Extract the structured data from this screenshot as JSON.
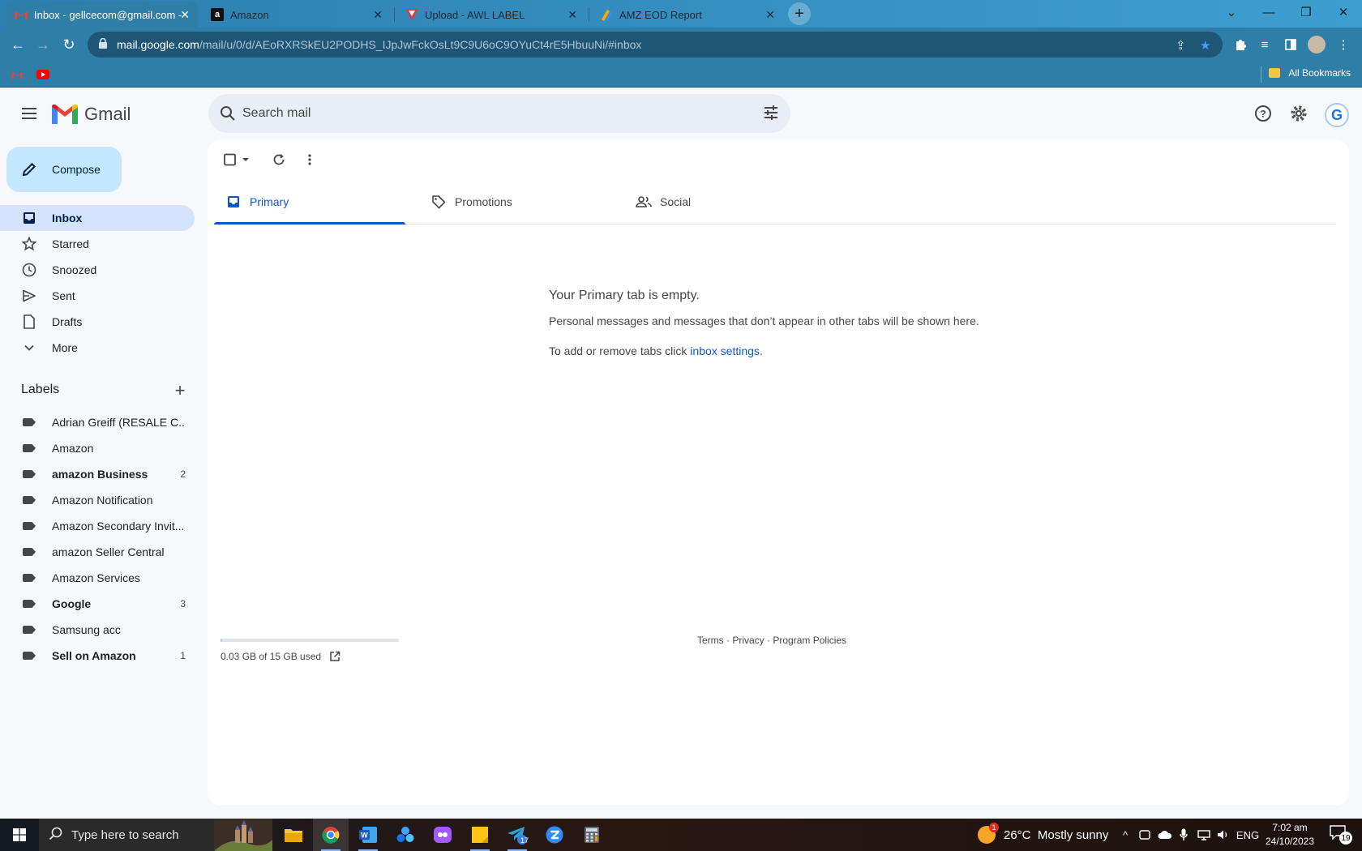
{
  "browser": {
    "tabs": [
      {
        "title": "Inbox - gellcecom@gmail.com -",
        "icon": "gmail-icon",
        "active": true
      },
      {
        "title": "Amazon",
        "icon": "amazon-icon",
        "active": false
      },
      {
        "title": "Upload - AWL LABEL",
        "icon": "awl-icon",
        "active": false
      },
      {
        "title": "AMZ EOD Report",
        "icon": "report-icon",
        "active": false
      }
    ],
    "url_host": "mail.google.com",
    "url_path": "/mail/u/0/d/AEoRXRSkEU2PODHS_IJpJwFckOsLt9C9U6oC9OYuCt4rE5HbuuNi/#inbox",
    "bookmarks_label": "All Bookmarks"
  },
  "gmail": {
    "logo_text": "Gmail",
    "search_placeholder": "Search mail",
    "compose_label": "Compose",
    "nav": [
      {
        "label": "Inbox",
        "icon": "inbox-icon",
        "active": true
      },
      {
        "label": "Starred",
        "icon": "star-icon"
      },
      {
        "label": "Snoozed",
        "icon": "clock-icon"
      },
      {
        "label": "Sent",
        "icon": "send-icon"
      },
      {
        "label": "Drafts",
        "icon": "draft-icon"
      },
      {
        "label": "More",
        "icon": "chevron-down-icon"
      }
    ],
    "labels_title": "Labels",
    "labels": [
      {
        "name": "Adrian Greiff (RESALE C...",
        "count": "",
        "bold": false
      },
      {
        "name": "Amazon",
        "count": "",
        "bold": false
      },
      {
        "name": "amazon Business",
        "count": "2",
        "bold": true
      },
      {
        "name": "Amazon Notification",
        "count": "",
        "bold": false
      },
      {
        "name": "Amazon Secondary Invit...",
        "count": "",
        "bold": false
      },
      {
        "name": "amazon Seller Central",
        "count": "",
        "bold": false
      },
      {
        "name": "Amazon Services",
        "count": "",
        "bold": false
      },
      {
        "name": "Google",
        "count": "3",
        "bold": true
      },
      {
        "name": "Samsung acc",
        "count": "",
        "bold": false
      },
      {
        "name": "Sell on Amazon",
        "count": "1",
        "bold": true
      }
    ],
    "tabs": [
      {
        "label": "Primary",
        "icon": "inbox-tab-icon",
        "active": true
      },
      {
        "label": "Promotions",
        "icon": "tag-icon",
        "active": false
      },
      {
        "label": "Social",
        "icon": "people-icon",
        "active": false
      }
    ],
    "empty": {
      "title": "Your Primary tab is empty.",
      "line1": "Personal messages and messages that don’t appear in other tabs will be shown here.",
      "line2_prefix": "To add or remove tabs click ",
      "line2_link": "inbox settings",
      "line2_suffix": "."
    },
    "storage": {
      "text": "0.03 GB of 15 GB used",
      "used_fraction": 0.002
    },
    "footer": {
      "terms": "Terms",
      "sep": " · ",
      "privacy": "Privacy",
      "policies": "Program Policies"
    },
    "avatar_letter": "G"
  },
  "taskbar": {
    "search_placeholder": "Type here to search",
    "telegram_badge": "17",
    "weather": "26°C  Mostly sunny",
    "weather_badge": "1",
    "language": "ENG",
    "time": "7:02 am",
    "date": "24/10/2023",
    "notifications": "19"
  },
  "colors": {
    "accent": "#0b57d0",
    "compose_bg": "#c2e7ff",
    "active_nav_bg": "#d3e3fd",
    "browser_chrome": "#2f7ea8"
  }
}
